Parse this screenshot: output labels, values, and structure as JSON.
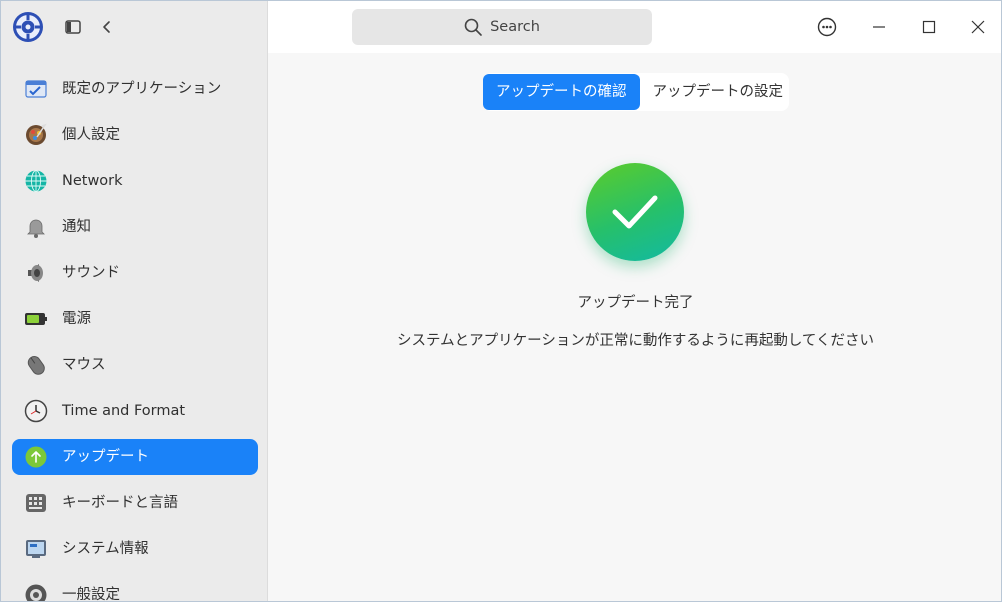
{
  "sidebar": {
    "items": [
      {
        "label": "既定のアプリケーション",
        "icon": "default-apps-icon",
        "active": false
      },
      {
        "label": "個人設定",
        "icon": "personalization-icon",
        "active": false
      },
      {
        "label": "Network",
        "icon": "network-globe-icon",
        "active": false
      },
      {
        "label": "通知",
        "icon": "bell-icon",
        "active": false
      },
      {
        "label": "サウンド",
        "icon": "speaker-icon",
        "active": false
      },
      {
        "label": "電源",
        "icon": "battery-icon",
        "active": false
      },
      {
        "label": "マウス",
        "icon": "mouse-icon",
        "active": false
      },
      {
        "label": "Time and Format",
        "icon": "clock-icon",
        "active": false
      },
      {
        "label": "アップデート",
        "icon": "update-arrow-icon",
        "active": true
      },
      {
        "label": "キーボードと言語",
        "icon": "keyboard-icon",
        "active": false
      },
      {
        "label": "システム情報",
        "icon": "system-info-icon",
        "active": false
      },
      {
        "label": "一般設定",
        "icon": "general-settings-icon",
        "active": false
      }
    ]
  },
  "header": {
    "search_placeholder": "Search"
  },
  "tabs": [
    {
      "label": "アップデートの確認",
      "active": true
    },
    {
      "label": "アップデートの設定",
      "active": false
    }
  ],
  "status": {
    "title": "アップデート完了",
    "description": "システムとアプリケーションが正常に動作するように再起動してください"
  },
  "colors": {
    "accent": "#1a82f8",
    "success": "#26c06b"
  }
}
